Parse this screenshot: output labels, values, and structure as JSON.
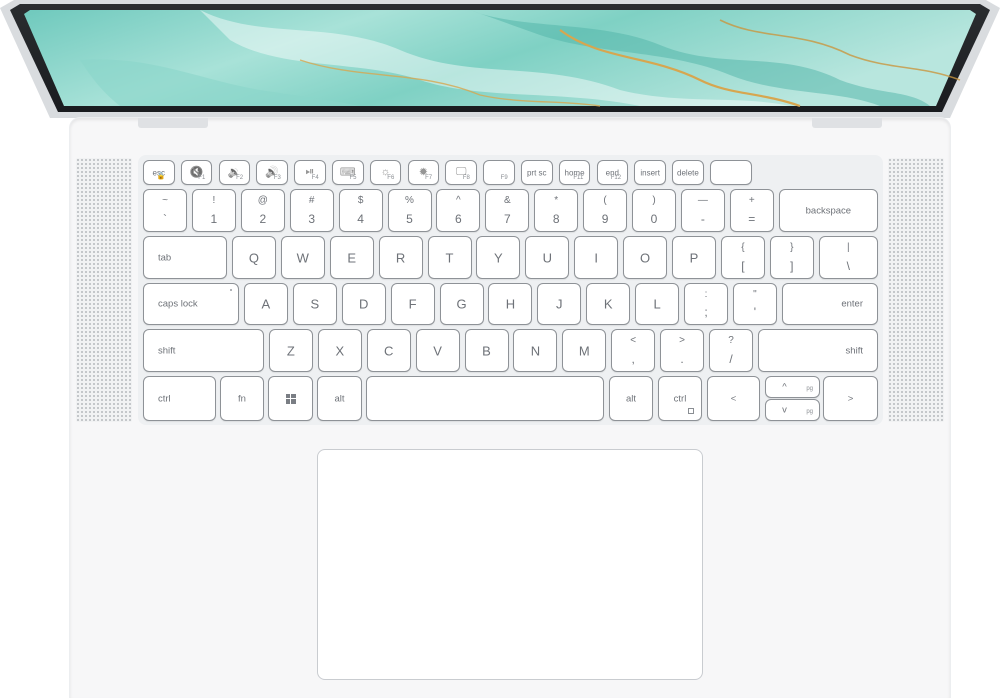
{
  "scene": {
    "subject": "laptop-top-view",
    "colors": {
      "deck": "#f7f7f8",
      "key_face": "#ffffff",
      "key_border": "#8e9297",
      "legend": "#6e7278",
      "screen_teal": "#7fd1c4",
      "screen_gold": "#d7a64f"
    }
  },
  "keyboard": {
    "fn_row": [
      {
        "main": "esc",
        "sub": "🔒"
      },
      {
        "icon": "mute-icon",
        "glyph": "🔇",
        "sub": "F1"
      },
      {
        "icon": "volume-down-icon",
        "glyph": "🔉",
        "sub": "F2"
      },
      {
        "icon": "volume-up-icon",
        "glyph": "🔊",
        "sub": "F3"
      },
      {
        "icon": "play-pause-icon",
        "glyph": "⏯",
        "sub": "F4"
      },
      {
        "icon": "keyboard-backlight-icon",
        "glyph": "⌨",
        "sub": "F5"
      },
      {
        "icon": "brightness-down-icon",
        "glyph": "☼",
        "sub": "F6"
      },
      {
        "icon": "brightness-up-icon",
        "glyph": "✹",
        "sub": "F7"
      },
      {
        "icon": "display-switch-icon",
        "glyph": "🖵",
        "sub": "F8"
      },
      {
        "icon": "",
        "glyph": "",
        "sub": "F9"
      },
      {
        "main": "prt sc",
        "sub": ""
      },
      {
        "main": "home",
        "sub": "F11"
      },
      {
        "main": "end",
        "sub": "F12"
      },
      {
        "main": "insert",
        "sub": ""
      },
      {
        "main": "delete",
        "sub": ""
      },
      {
        "main": "",
        "sub": ""
      }
    ],
    "num_row": [
      {
        "top": "~",
        "bot": "`"
      },
      {
        "top": "!",
        "bot": "1"
      },
      {
        "top": "@",
        "bot": "2"
      },
      {
        "top": "#",
        "bot": "3"
      },
      {
        "top": "$",
        "bot": "4"
      },
      {
        "top": "%",
        "bot": "5"
      },
      {
        "top": "^",
        "bot": "6"
      },
      {
        "top": "&",
        "bot": "7"
      },
      {
        "top": "*",
        "bot": "8"
      },
      {
        "top": "(",
        "bot": "9"
      },
      {
        "top": ")",
        "bot": "0"
      },
      {
        "top": "—",
        "bot": "-"
      },
      {
        "top": "+",
        "bot": "="
      },
      {
        "word": "backspace"
      }
    ],
    "q_row": [
      "tab",
      "Q",
      "W",
      "E",
      "R",
      "T",
      "Y",
      "U",
      "I",
      "O",
      "P",
      {
        "top": "{",
        "bot": "["
      },
      {
        "top": "}",
        "bot": "]"
      },
      {
        "top": "|",
        "bot": "\\"
      }
    ],
    "a_row": [
      "caps lock",
      "A",
      "S",
      "D",
      "F",
      "G",
      "H",
      "J",
      "K",
      "L",
      {
        "top": ":",
        "bot": ";"
      },
      {
        "top": "\"",
        "bot": "'"
      },
      "enter"
    ],
    "z_row": [
      "shift",
      "Z",
      "X",
      "C",
      "V",
      "B",
      "N",
      "M",
      {
        "top": "<",
        "bot": ","
      },
      {
        "top": ">",
        "bot": "."
      },
      {
        "top": "?",
        "bot": "/"
      },
      "shift"
    ],
    "bottom_row": {
      "ctrl_left": "ctrl",
      "fn": "fn",
      "alt_left": "alt",
      "space": "",
      "alt_right": "alt",
      "ctrl_right": "ctrl",
      "left": "<",
      "pgup": "pg",
      "pgdn": "pg",
      "up_glyph": "^",
      "down_glyph": "v",
      "right": ">"
    }
  }
}
